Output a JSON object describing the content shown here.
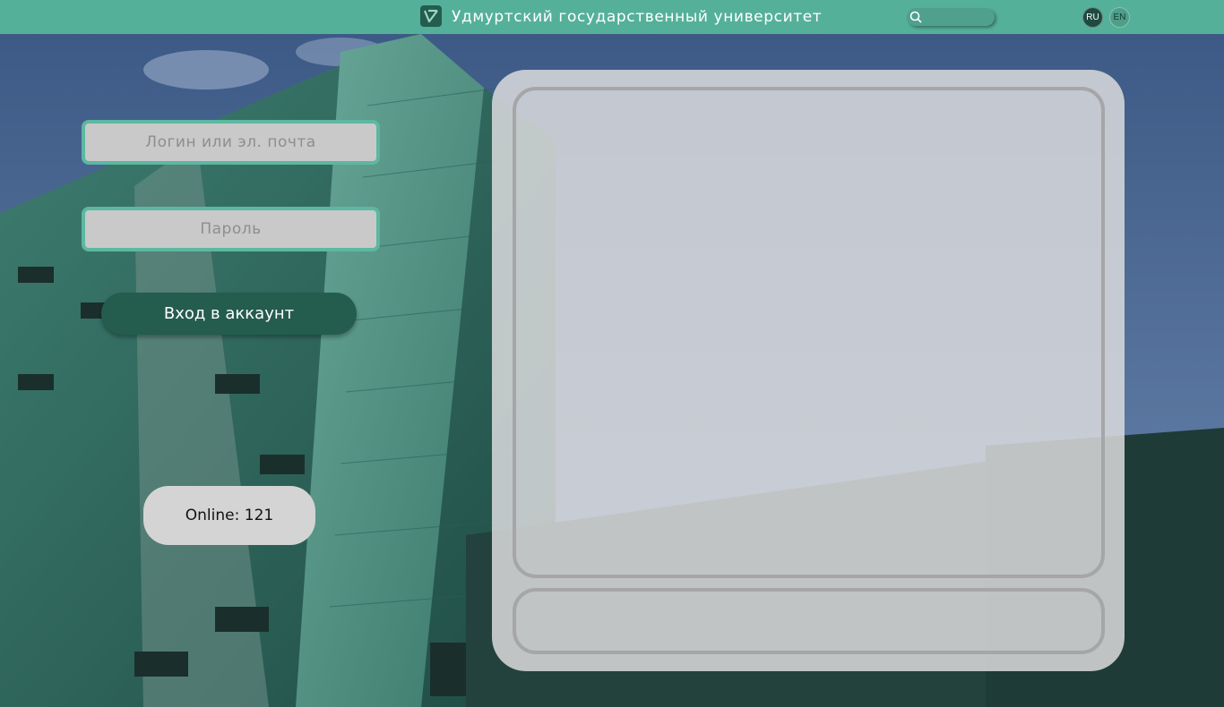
{
  "header": {
    "title": "Удмуртский государственный университет",
    "logo_icon": "udsu-logo-icon",
    "search_icon": "search-icon",
    "search_value": "",
    "languages": [
      "RU",
      "EN"
    ],
    "active_language": "RU",
    "bar_color": "#55b09a"
  },
  "login": {
    "login_placeholder": "Логин или эл. почта",
    "password_placeholder": "Пароль",
    "submit_label": "Вход в аккаунт",
    "accent_color": "#5cb8a0",
    "button_color": "#245c4e"
  },
  "status": {
    "online_text": "Online: 121"
  },
  "colors": {
    "panel_background": "#dadadc",
    "panel_border": "#a6a6a8"
  }
}
